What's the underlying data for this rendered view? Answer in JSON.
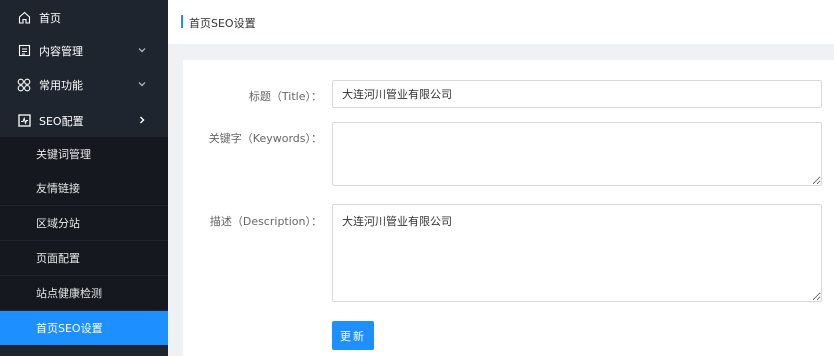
{
  "sidebar": {
    "items": [
      {
        "label": "首页",
        "icon": "home-icon"
      },
      {
        "label": "内容管理",
        "icon": "document-icon"
      },
      {
        "label": "常用功能",
        "icon": "grid-icon"
      },
      {
        "label": "SEO配置",
        "icon": "chart-box-icon"
      }
    ],
    "sub_items": [
      {
        "label": "关键词管理"
      },
      {
        "label": "友情链接"
      },
      {
        "label": "区域分站"
      },
      {
        "label": "页面配置"
      },
      {
        "label": "站点健康检测"
      },
      {
        "label": "首页SEO设置"
      }
    ],
    "active_color": "#1e8fff",
    "background": "#1f252f"
  },
  "breadcrumb": {
    "current": "首页SEO设置"
  },
  "form": {
    "title_label": "标题（Title）：",
    "title_value": "大连河川管业有限公司",
    "keywords_label": "关键字（Keywords）：",
    "keywords_value": "",
    "description_label": "描述（Description）：",
    "description_value": "大连河川管业有限公司",
    "submit_label": "更新"
  }
}
